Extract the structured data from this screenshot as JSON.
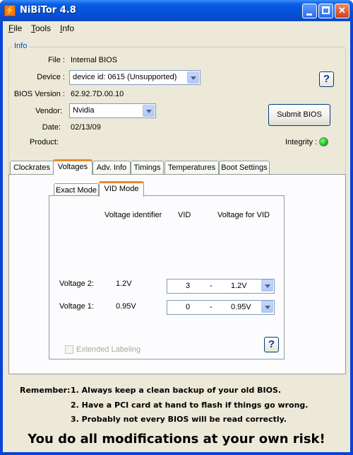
{
  "window": {
    "title": "NiBiTor 4.8"
  },
  "menu": [
    "File",
    "Tools",
    "Info"
  ],
  "info": {
    "group_label": "Info",
    "file_label": "File :",
    "file_value": "Internal BIOS",
    "device_label": "Device :",
    "device_value": "device id: 0615 (Unsupported)",
    "bios_version_label": "BIOS Version :",
    "bios_version_value": "62.92.7D.00.10",
    "vendor_label": "Vendor:",
    "vendor_value": "Nvidia",
    "date_label": "Date:",
    "date_value": "02/13/09",
    "product_label": "Product:",
    "product_value": "",
    "submit_label": "Submit BIOS",
    "integrity_label": "Integrity :",
    "integrity_color": "#0cc70c",
    "help_label": "?"
  },
  "tabs": [
    "Clockrates",
    "Voltages",
    "Adv. Info",
    "Timings",
    "Temperatures",
    "Boot Settings"
  ],
  "active_tab": "Voltages",
  "subtabs": [
    "Exact Mode",
    "VID Mode"
  ],
  "active_subtab": "VID Mode",
  "voltage_table": {
    "headers": [
      "Voltage identifier",
      "VID",
      "Voltage for VID"
    ],
    "rows": [
      {
        "label": "Voltage 2:",
        "identifier": "1.2V",
        "vid": "3",
        "sep": "-",
        "voltage": "1.2V"
      },
      {
        "label": "Voltage 1:",
        "identifier": "0.95V",
        "vid": "0",
        "sep": "-",
        "voltage": "0.95V"
      }
    ],
    "extended_labeling": "Extended Labeling",
    "help_label": "?"
  },
  "reminder": {
    "prefix": "Remember:",
    "lines": [
      "1. Always keep a clean backup of your old BIOS.",
      "2. Have a PCI card at hand to flash if things go wrong.",
      "3. Probably not every BIOS will be read correctly."
    ]
  },
  "warning": "You do all modifications at your own risk!"
}
